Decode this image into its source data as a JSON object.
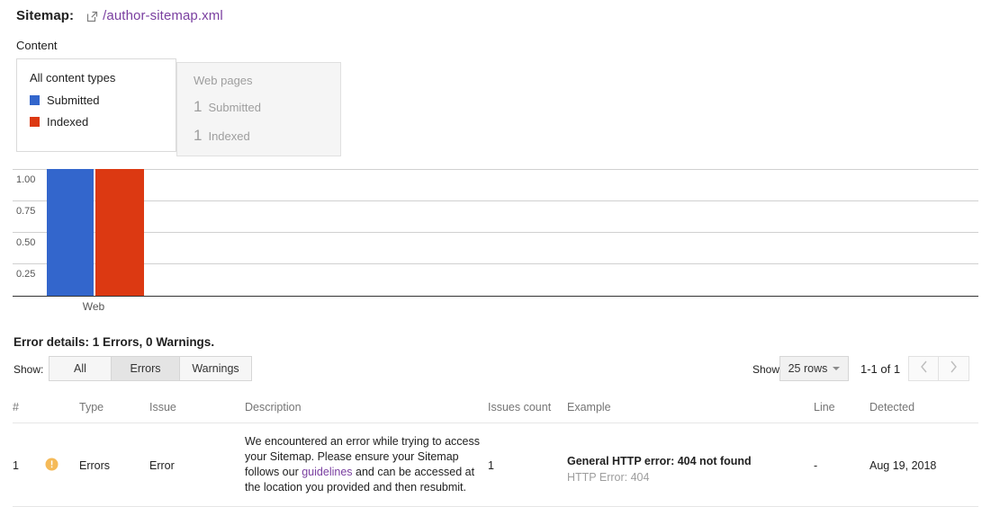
{
  "header": {
    "label": "Sitemap:",
    "link_icon": "external-link-icon",
    "link_text": "/author-sitemap.xml",
    "link_color": "#7a3fa0"
  },
  "content": {
    "section_label": "Content",
    "cards": [
      {
        "title": "All content types",
        "legend": [
          {
            "label": "Submitted",
            "color": "#3366cc"
          },
          {
            "label": "Indexed",
            "color": "#dc3912"
          }
        ]
      },
      {
        "title": "Web pages",
        "stats": [
          {
            "value": "1",
            "label": "Submitted"
          },
          {
            "value": "1",
            "label": "Indexed"
          }
        ]
      }
    ]
  },
  "chart_data": {
    "type": "bar",
    "title": "",
    "xlabel": "",
    "ylabel": "",
    "categories": [
      "Web"
    ],
    "series": [
      {
        "name": "Submitted",
        "values": [
          1
        ],
        "color": "#3366cc"
      },
      {
        "name": "Indexed",
        "values": [
          1
        ],
        "color": "#dc3912"
      }
    ],
    "ylim": [
      0,
      1
    ],
    "yticks": [
      "0.25",
      "0.50",
      "0.75",
      "1.00"
    ],
    "grid": true,
    "legend_position": "card-above"
  },
  "errors": {
    "summary": "Error details: 1 Errors, 0 Warnings.",
    "show_label": "Show:",
    "filters": [
      {
        "label": "All",
        "selected": false
      },
      {
        "label": "Errors",
        "selected": true
      },
      {
        "label": "Warnings",
        "selected": false
      }
    ]
  },
  "pagination": {
    "show_label": "Show",
    "rows_value": "25 rows",
    "range": "1-1 of 1",
    "prev_icon": "chevron-left-icon",
    "next_icon": "chevron-right-icon"
  },
  "table": {
    "headers": {
      "num": "#",
      "type": "Type",
      "issue": "Issue",
      "description": "Description",
      "issues_count": "Issues count",
      "example": "Example",
      "line": "Line",
      "detected": "Detected"
    },
    "rows": [
      {
        "num": "1",
        "status_icon": "warning-icon",
        "type": "Errors",
        "issue": "Error",
        "description_part1": "We encountered an error while trying to access your Sitemap. Please ensure your Sitemap follows our ",
        "description_link": "guidelines",
        "description_part2": " and can be accessed at the location you provided and then resubmit.",
        "issues_count": "1",
        "example_main": "General HTTP error: 404 not found",
        "example_sub": "HTTP Error: 404",
        "line": "-",
        "detected": "Aug 19, 2018"
      }
    ]
  }
}
